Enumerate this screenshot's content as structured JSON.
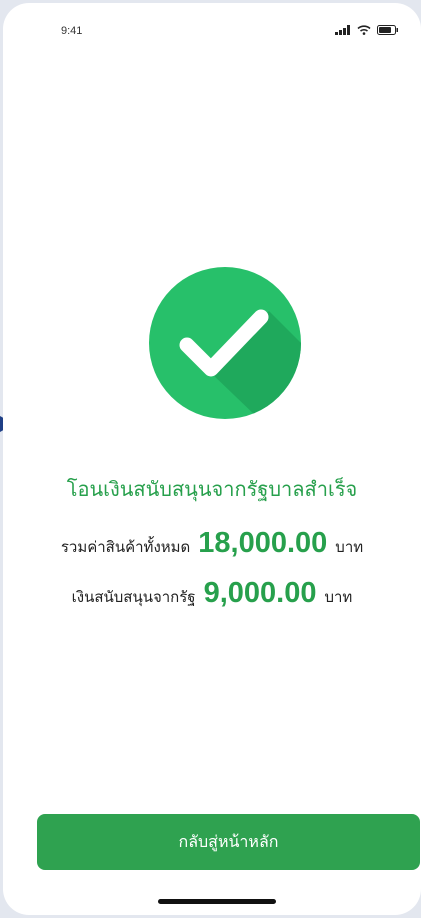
{
  "status_bar": {
    "time": "9:41",
    "icons": [
      "signal-icon",
      "wifi-icon",
      "battery-icon"
    ]
  },
  "success": {
    "icon": "checkmark-icon",
    "title": "โอนเงินสนับสนุนจากรัฐบาลสำเร็จ"
  },
  "summary": {
    "total": {
      "label": "รวมค่าสินค้าทั้งหมด",
      "amount": "18,000.00",
      "unit": "บาท"
    },
    "subsidy": {
      "label": "เงินสนับสนุนจากรัฐ",
      "amount": "9,000.00",
      "unit": "บาท"
    }
  },
  "actions": {
    "home_label": "กลับสู่หน้าหลัก"
  },
  "colors": {
    "accent": "#27a04c",
    "success_circle": "#27c06a",
    "button": "#2fa250"
  }
}
